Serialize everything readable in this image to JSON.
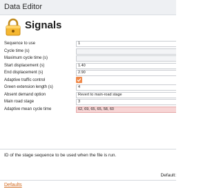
{
  "window": {
    "title": "Data Editor"
  },
  "header": {
    "title": "Signals",
    "icon": "padlock-signal-icon"
  },
  "fields": [
    {
      "label": "Sequence to use",
      "value": "1",
      "kind": "text"
    },
    {
      "label": "Cycle time (s)",
      "value": "",
      "kind": "empty"
    },
    {
      "label": "Maximum cycle time (s)",
      "value": "",
      "kind": "empty"
    },
    {
      "label": "Start displacement (s)",
      "value": "1.40",
      "kind": "text"
    },
    {
      "label": "End displacement (s)",
      "value": "2.90",
      "kind": "text"
    },
    {
      "label": "Adaptive traffic control",
      "value": "checked",
      "kind": "checkbox"
    },
    {
      "label": "Green extension length (s)",
      "value": "4",
      "kind": "text"
    },
    {
      "label": "Absent demand option",
      "value": "Revert to main-road stage",
      "kind": "select"
    },
    {
      "label": "Main road stage",
      "value": "3",
      "kind": "text"
    },
    {
      "label": "Adaptive mean cycle time",
      "value": "62, 69, 65, 65, 58, 60",
      "kind": "error"
    }
  ],
  "description": {
    "text": "ID of the stage sequence to be used when the file is run.",
    "default_label": "Default:"
  },
  "footer": {
    "defaults_link": "Defaults"
  },
  "colors": {
    "accent": "#f08a4b",
    "error_bg": "#f7d5d5",
    "link": "#d2691e"
  }
}
